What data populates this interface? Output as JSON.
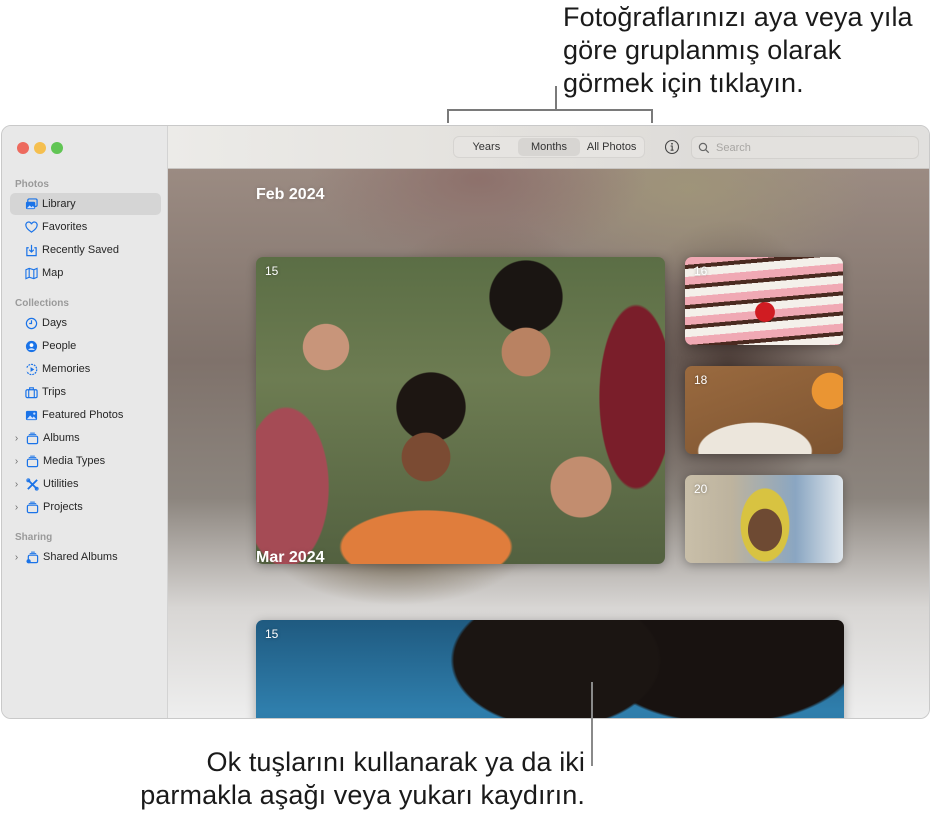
{
  "callouts": {
    "top": "Fotoğraflarınızı aya veya yıla göre gruplanmış olarak görmek için tıklayın.",
    "bottom": "Ok tuşlarını kullanarak ya da iki parmakla aşağı veya yukarı kaydırın."
  },
  "window": {
    "traffic_lights": [
      "close",
      "minimize",
      "zoom"
    ]
  },
  "sidebar": {
    "sections": [
      {
        "title": "Photos",
        "items": [
          {
            "label": "Library",
            "icon": "photo-library-icon",
            "selected": true
          },
          {
            "label": "Favorites",
            "icon": "heart-icon"
          },
          {
            "label": "Recently Saved",
            "icon": "tray-download-icon"
          },
          {
            "label": "Map",
            "icon": "map-icon"
          }
        ]
      },
      {
        "title": "Collections",
        "items": [
          {
            "label": "Days",
            "icon": "clock-icon"
          },
          {
            "label": "People",
            "icon": "person-circle-icon"
          },
          {
            "label": "Memories",
            "icon": "memories-play-icon"
          },
          {
            "label": "Trips",
            "icon": "suitcase-icon"
          },
          {
            "label": "Featured Photos",
            "icon": "photo-icon"
          },
          {
            "label": "Albums",
            "icon": "album-stack-icon",
            "expandable": true
          },
          {
            "label": "Media Types",
            "icon": "album-stack-icon",
            "expandable": true
          },
          {
            "label": "Utilities",
            "icon": "tools-icon",
            "expandable": true
          },
          {
            "label": "Projects",
            "icon": "album-stack-icon",
            "expandable": true
          }
        ]
      },
      {
        "title": "Sharing",
        "items": [
          {
            "label": "Shared Albums",
            "icon": "shared-album-icon",
            "expandable": true
          }
        ]
      }
    ]
  },
  "toolbar": {
    "view_options": [
      {
        "label": "Years"
      },
      {
        "label": "Months",
        "active": true
      },
      {
        "label": "All Photos"
      }
    ],
    "info_icon": "info-circle-icon",
    "search": {
      "placeholder": "Search",
      "value": ""
    }
  },
  "library": {
    "months": [
      {
        "title": "Feb 2024",
        "photos": [
          {
            "day": "15",
            "subject": "group selfie"
          },
          {
            "day": "16",
            "subject": "cake with cherry"
          },
          {
            "day": "18",
            "subject": "plates of food"
          },
          {
            "day": "20",
            "subject": "person in yellow hood at beach"
          }
        ]
      },
      {
        "title": "Mar 2024",
        "photos": [
          {
            "day": "15",
            "subject": "two people with curly hair"
          }
        ]
      }
    ]
  }
}
